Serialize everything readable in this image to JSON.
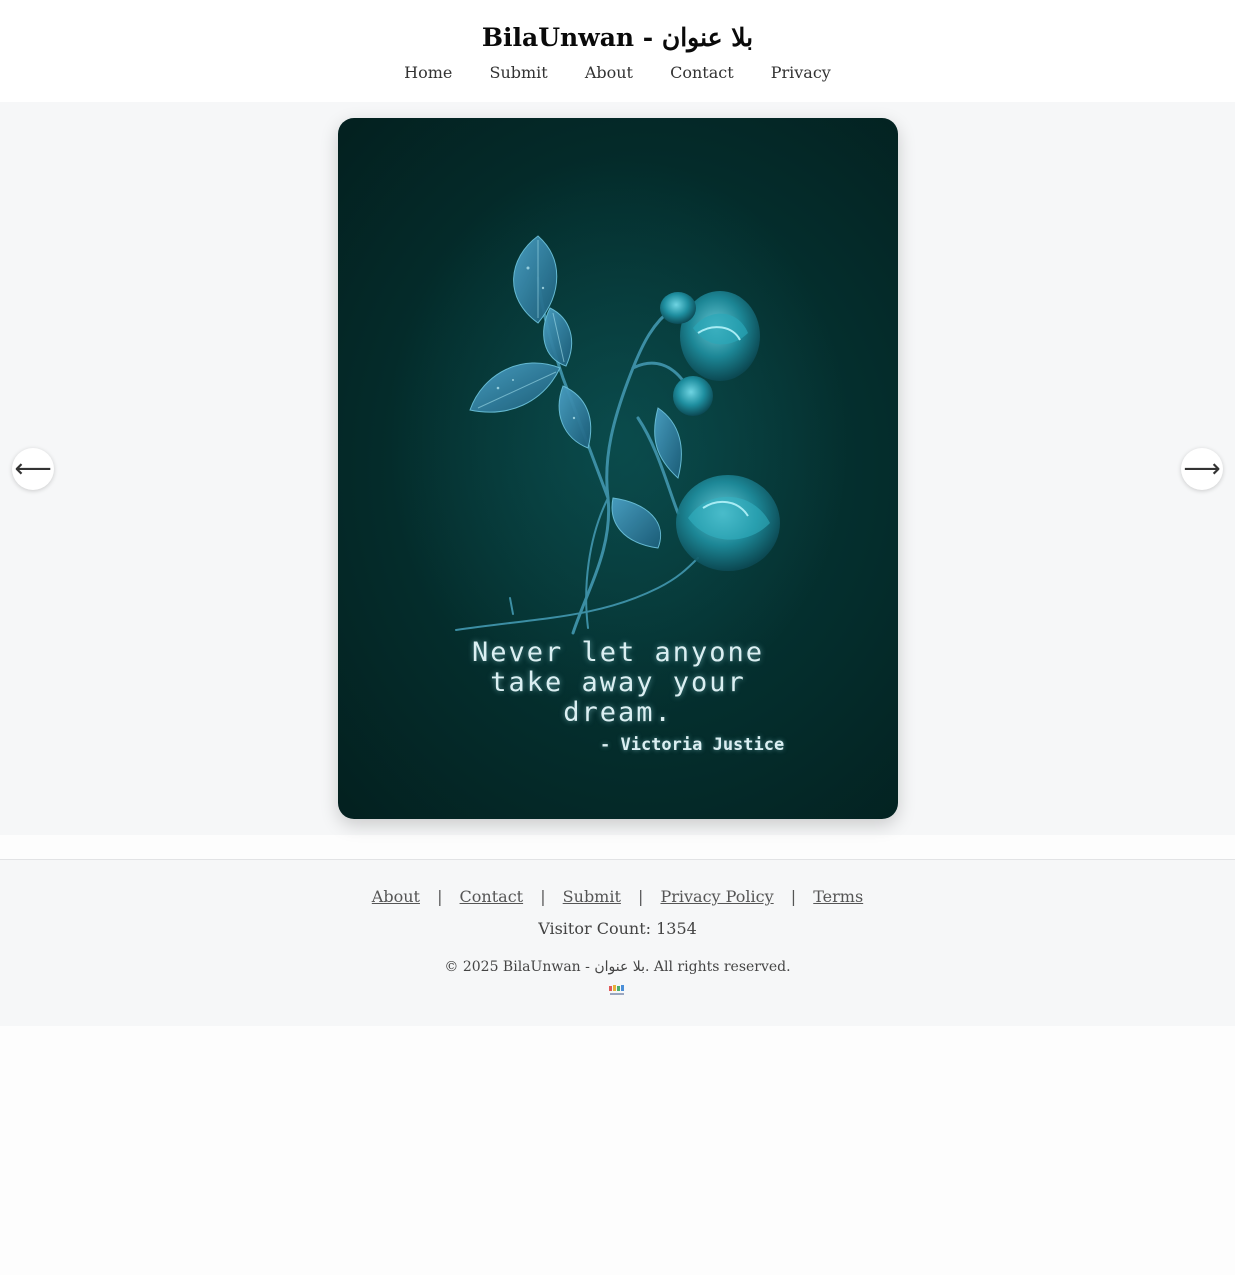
{
  "header": {
    "title": "BilaUnwan - بلا عنوان",
    "nav": [
      "Home",
      "Submit",
      "About",
      "Contact",
      "Privacy"
    ]
  },
  "carousel": {
    "quote_lines": [
      "Never let anyone",
      "take away your",
      "dream."
    ],
    "author": "- Victoria Justice",
    "prev_icon": "arrow-left-icon",
    "next_icon": "arrow-right-icon",
    "prev_glyph": "⟵",
    "next_glyph": "⟶"
  },
  "footer": {
    "links": [
      "About",
      "Contact",
      "Submit",
      "Privacy Policy",
      "Terms"
    ],
    "separator": "|",
    "visitor_count": "Visitor Count: 1354",
    "copyright": "© 2025 BilaUnwan - بلا عنوان. All rights reserved."
  },
  "colors": {
    "card_bg": "#042d2c",
    "flower": "#2aa6b8",
    "quote_text": "#dbeff2",
    "footer_bg": "#f6f7f8"
  }
}
